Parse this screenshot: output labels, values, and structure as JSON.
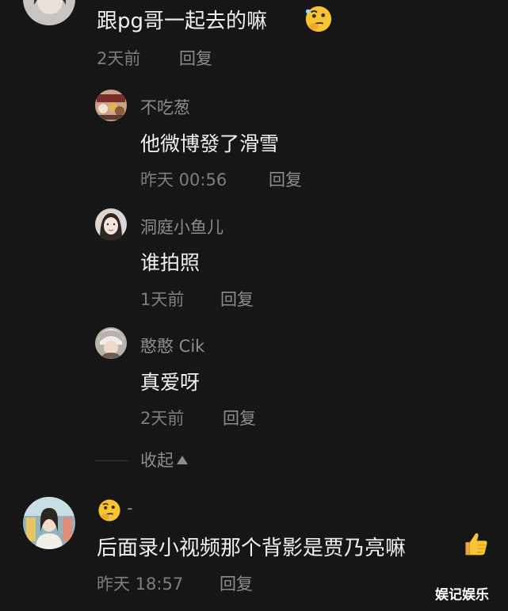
{
  "comments": [
    {
      "content": "跟pg哥一起去的嘛",
      "time": "2天前",
      "reply_label": "回复",
      "emoji": "thinking-face-emoji"
    },
    {
      "replies": [
        {
          "user": "不吃葱",
          "content": "他微博發了滑雪",
          "time": "昨天 00:56",
          "reply_label": "回复"
        },
        {
          "user": "洞庭小鱼儿",
          "content": "谁拍照",
          "time": "1天前",
          "reply_label": "回复"
        },
        {
          "user": "憨憨 Cik",
          "content": "真爱呀",
          "time": "2天前",
          "reply_label": "回复"
        }
      ],
      "collapse_label": "收起"
    },
    {
      "user_suffix": "-",
      "content": "后面录小视频那个背影是贾乃亮嘛",
      "time": "昨天 18:57",
      "reply_label": "回复",
      "emoji": "thumbs-up-emoji"
    }
  ],
  "watermark": "娱记娱乐",
  "colors": {
    "background": "#161616",
    "text_primary": "#f0f0f0",
    "text_secondary": "#8c8c8c"
  }
}
